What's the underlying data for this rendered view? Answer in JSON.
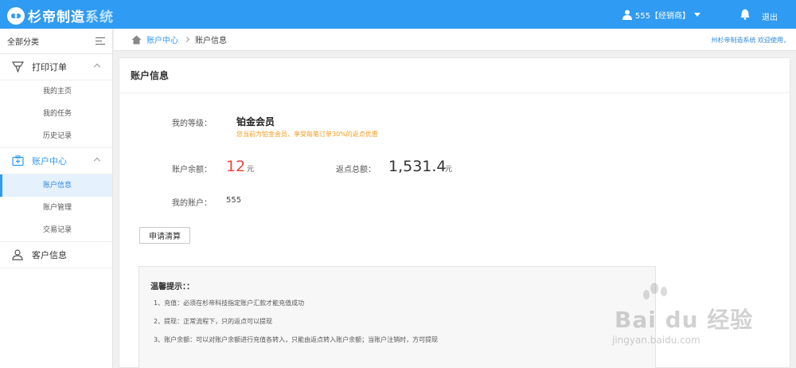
{
  "header": {
    "app_name": "杉帝制造",
    "app_suffix": "系统",
    "user": "555【经销商】",
    "logout": "退出"
  },
  "sidebar": {
    "all_categories": "全部分类",
    "groups": [
      {
        "label": "打印订单",
        "items": [
          "我的主页",
          "我的任务",
          "历史记录"
        ]
      },
      {
        "label": "账户中心",
        "items": [
          "账户信息",
          "账户管理",
          "交易记录"
        ]
      },
      {
        "label": "客户信息",
        "items": []
      }
    ]
  },
  "breadcrumb": {
    "home": "账户中心",
    "current": "账户信息",
    "right_text": "州杉帝制造系统 欢迎使用，"
  },
  "panel": {
    "title": "账户信息",
    "level_label": "我的等级：",
    "level_value": "铂金会员",
    "level_hint": "您当前为铂金会员，享受每笔订单30%的返点优惠",
    "balance_label": "账户余额：",
    "balance_value": "12",
    "balance_unit": "元",
    "rebate_label": "返点总额：",
    "rebate_value": "1,531.4",
    "rebate_unit": "元",
    "account_label": "我的账户：",
    "account_value": "555",
    "settle_button": "申请清算"
  },
  "tips": {
    "title": "温馨提示：：",
    "items": [
      "1、充值：必须在杉帝科技指定账户汇款才能充值成功",
      "2、提现：正常流程下，只的返点可以提现",
      "3、账户余额：可以对账户余额进行充值各转入，只能由返点转入账户余额；当账户注销时，方可提现"
    ]
  },
  "watermark": {
    "brand": "Bai du 经验",
    "url": "jingyan.baidu.com"
  },
  "colors": {
    "primary": "#2f9bf2",
    "balance": "#e8473e",
    "hint": "#f29c1f"
  }
}
